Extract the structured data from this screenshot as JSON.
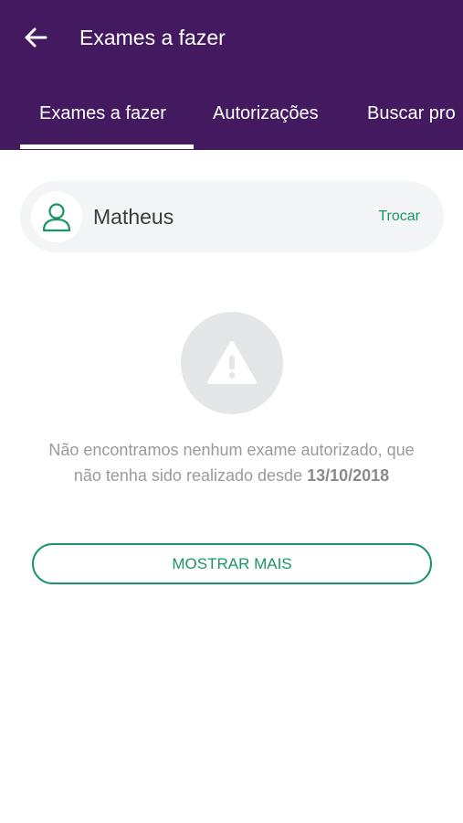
{
  "header": {
    "back_icon": "arrow-left-icon",
    "title": "Exames a fazer",
    "background_color": "#43195f"
  },
  "tabs": [
    {
      "label": "Exames a fazer",
      "selected": true
    },
    {
      "label": "Autorizações",
      "selected": false
    },
    {
      "label": "Buscar pro",
      "selected": false
    }
  ],
  "user_card": {
    "avatar_icon": "user-icon",
    "name": "Matheus",
    "switch_label": "Trocar"
  },
  "empty_state": {
    "icon": "warning-icon",
    "message": "Não encontramos nenhum exame autorizado, que não tenha sido realizado desde",
    "date": "13/10/2018"
  },
  "actions": {
    "show_more_label": "MOSTRAR MAIS",
    "accent_color": "#1a9464"
  }
}
